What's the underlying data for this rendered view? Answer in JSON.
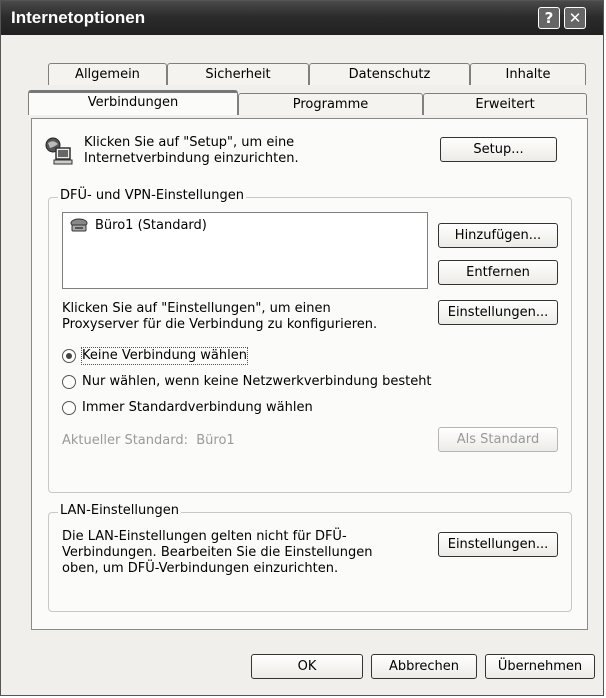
{
  "window": {
    "title": "Internetoptionen",
    "help_glyph": "?",
    "close_glyph": "✕"
  },
  "tabs": {
    "row1": [
      "Allgemein",
      "Sicherheit",
      "Datenschutz",
      "Inhalte"
    ],
    "row2": [
      "Verbindungen",
      "Programme",
      "Erweitert"
    ],
    "selected": "Verbindungen"
  },
  "setup": {
    "text_line1": "Klicken Sie auf \"Setup\", um eine",
    "text_line2": "Internetverbindung einzurichten.",
    "button": "Setup..."
  },
  "dialup": {
    "legend": "DFÜ- und VPN-Einstellungen",
    "connections": [
      "Büro1 (Standard)"
    ],
    "add_button": "Hinzufügen...",
    "remove_button": "Entfernen",
    "settings_button": "Einstellungen...",
    "proxy_text_line1": "Klicken Sie auf \"Einstellungen\", um einen",
    "proxy_text_line2": "Proxyserver für die Verbindung zu konfigurieren.",
    "radio_options": [
      "Keine Verbindung wählen",
      "Nur wählen, wenn keine Netzwerkverbindung besteht",
      "Immer Standardverbindung wählen"
    ],
    "selected_option": "Keine Verbindung wählen",
    "current_default_label": "Aktueller Standard:",
    "current_default_value": "Büro1",
    "set_default_button": "Als Standard"
  },
  "lan": {
    "legend": "LAN-Einstellungen",
    "text_line1": "Die LAN-Einstellungen gelten nicht für DFÜ-",
    "text_line2": "Verbindungen. Bearbeiten Sie die Einstellungen",
    "text_line3": "oben, um DFÜ-Verbindungen einzurichten.",
    "settings_button": "Einstellungen..."
  },
  "footer": {
    "ok": "OK",
    "cancel": "Abbrechen",
    "apply": "Übernehmen"
  }
}
